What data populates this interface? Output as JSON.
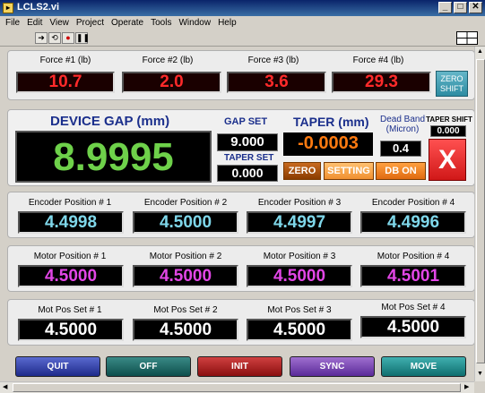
{
  "window": {
    "title": "LCLS2.vi",
    "icon": "vi-icon",
    "buttons": [
      "_",
      "□",
      "✕"
    ]
  },
  "menu": [
    "File",
    "Edit",
    "View",
    "Project",
    "Operate",
    "Tools",
    "Window",
    "Help"
  ],
  "toolbar": {
    "run": "➜",
    "continuous": "⟲",
    "abort": "●",
    "pause": "❚❚"
  },
  "force": {
    "labels": [
      "Force #1 (lb)",
      "Force #2 (lb)",
      "Force #3 (lb)",
      "Force #4 (lb)"
    ],
    "values": [
      "10.7",
      "2.0",
      "3.6",
      "29.3"
    ],
    "zero_shift_label": [
      "ZERO",
      "SHIFT"
    ]
  },
  "gap": {
    "title": "DEVICE GAP (mm)",
    "value": "8.9995",
    "gap_set_label": "GAP SET",
    "gap_set_value": "9.000",
    "taper_set_label": "TAPER SET",
    "taper_set_value": "0.000",
    "taper_label": "TAPER (mm)",
    "taper_value": "-0.0003",
    "zero_label": "ZERO",
    "setting_label": "SETTING",
    "dead_band_label": [
      "Dead Band",
      "(Micron)"
    ],
    "dead_band_value": "0.4",
    "db_on_label": "DB ON",
    "taper_shift_label": "TAPER SHIFT",
    "taper_shift_value": "0.000",
    "x_label": "X"
  },
  "encoder": {
    "labels": [
      "Encoder Position # 1",
      "Encoder Position # 2",
      "Encoder Position # 3",
      "Encoder Position # 4"
    ],
    "values": [
      "4.4998",
      "4.5000",
      "4.4997",
      "4.4996"
    ]
  },
  "motor": {
    "labels": [
      "Motor Position # 1",
      "Motor Position # 2",
      "Motor Position # 3",
      "Motor Position # 4"
    ],
    "values": [
      "4.5000",
      "4.5000",
      "4.5000",
      "4.5001"
    ]
  },
  "motset": {
    "labels": [
      "Mot Pos Set # 1",
      "Mot Pos Set # 2",
      "Mot Pos Set # 3",
      "Mot Pos Set # 4"
    ],
    "values": [
      "4.5000",
      "4.5000",
      "4.5000",
      "4.5000"
    ]
  },
  "bottom_buttons": [
    "QUIT",
    "OFF",
    "INIT",
    "SYNC",
    "MOVE"
  ],
  "colors": {
    "force_red": "#ff2a2a",
    "gap_green": "#6ed14a",
    "taper_orange": "#ff7a10",
    "encoder_cyan": "#7fd7ea",
    "motor_magenta": "#e246e6",
    "label_blue": "#1b2f8c"
  }
}
